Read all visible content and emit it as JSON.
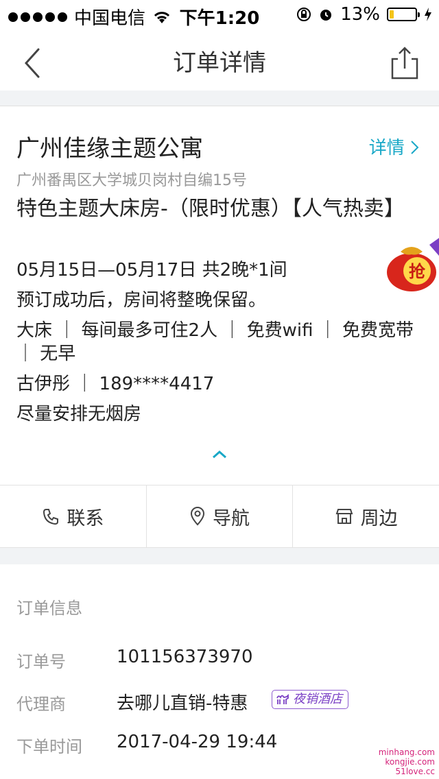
{
  "status_bar": {
    "carrier": "中国电信",
    "time": "下午1:20",
    "battery": "13%"
  },
  "nav": {
    "title": "订单详情"
  },
  "hotel": {
    "name": "广州佳缘主题公寓",
    "detail_link": "详情",
    "address": "广州番禺区大学城贝岗村自编15号",
    "room": "特色主题大床房-（限时优惠）【人气热卖】",
    "dates": "05月15日—05月17日 共2晚*1间",
    "note": "预订成功后，房间将整晚保留。",
    "amenities": "大床 ｜ 每间最多可住2人 ｜ 免费wifi ｜ 免费宽带 ｜ 无早",
    "guest": "古伊彤 ｜ 189****4417",
    "request": "尽量安排无烟房",
    "promo_text": "抢"
  },
  "actions": [
    {
      "label": "联系",
      "icon": "phone-icon"
    },
    {
      "label": "导航",
      "icon": "location-pin-icon"
    },
    {
      "label": "周边",
      "icon": "store-icon"
    }
  ],
  "order_info": {
    "title": "订单信息",
    "order_no_label": "订单号",
    "order_no": "101156373970",
    "agent_label": "代理商",
    "agent": "去哪儿直销-特惠",
    "agent_badge": "夜销酒店",
    "time_label": "下单时间",
    "time": "2017-04-29 19:44"
  },
  "watermark": {
    "line1": "minhang.com",
    "line2": "kongjie.com",
    "line3": "51love.cc"
  },
  "colors": {
    "accent": "#19a8c7",
    "background_gap": "#f1f3f5",
    "badge": "#7a3fc5",
    "watermark": "#d4237a"
  }
}
